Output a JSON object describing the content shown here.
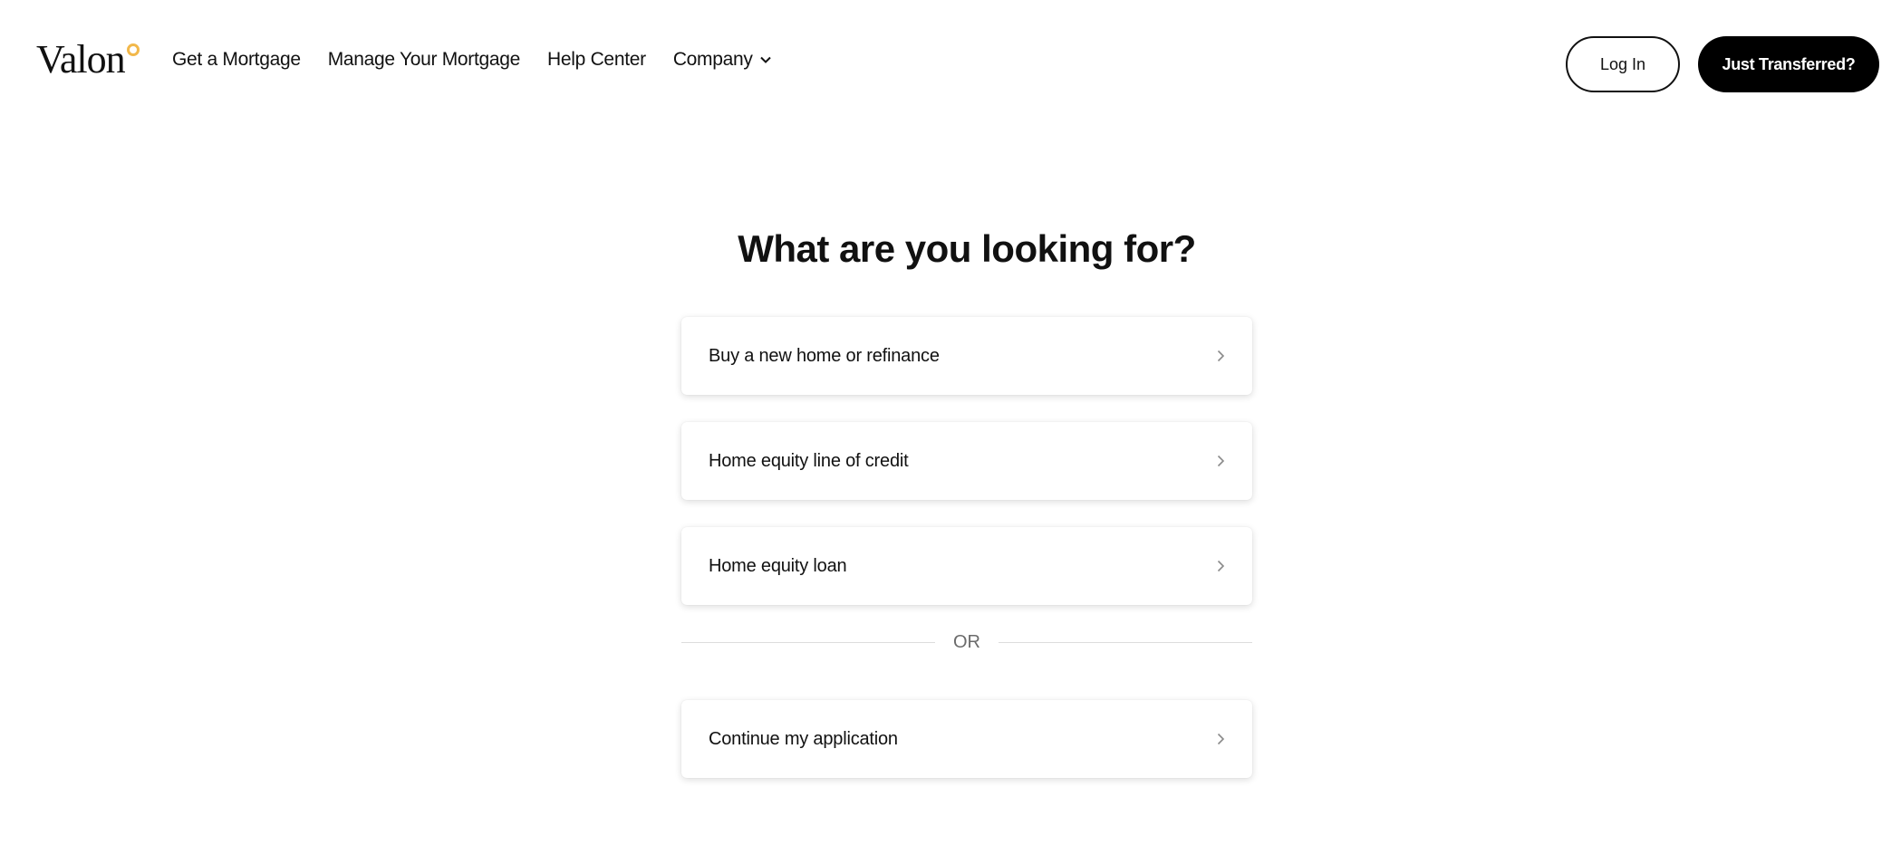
{
  "brand": {
    "name": "Valon",
    "accent_color": "#f2b84b"
  },
  "nav": {
    "items": [
      {
        "label": "Get a Mortgage"
      },
      {
        "label": "Manage Your Mortgage"
      },
      {
        "label": "Help Center"
      },
      {
        "label": "Company",
        "icon": "chevron-down-icon"
      }
    ]
  },
  "header_actions": {
    "login_label": "Log In",
    "transfer_label": "Just Transferred?"
  },
  "main": {
    "title": "What are you looking for?",
    "options": [
      {
        "label": "Buy a new home or refinance",
        "icon": "chevron-right-icon"
      },
      {
        "label": "Home equity line of credit",
        "icon": "chevron-right-icon"
      },
      {
        "label": "Home equity loan",
        "icon": "chevron-right-icon"
      }
    ],
    "divider_text": "OR",
    "continue_option": {
      "label": "Continue my application",
      "icon": "chevron-right-icon"
    }
  }
}
